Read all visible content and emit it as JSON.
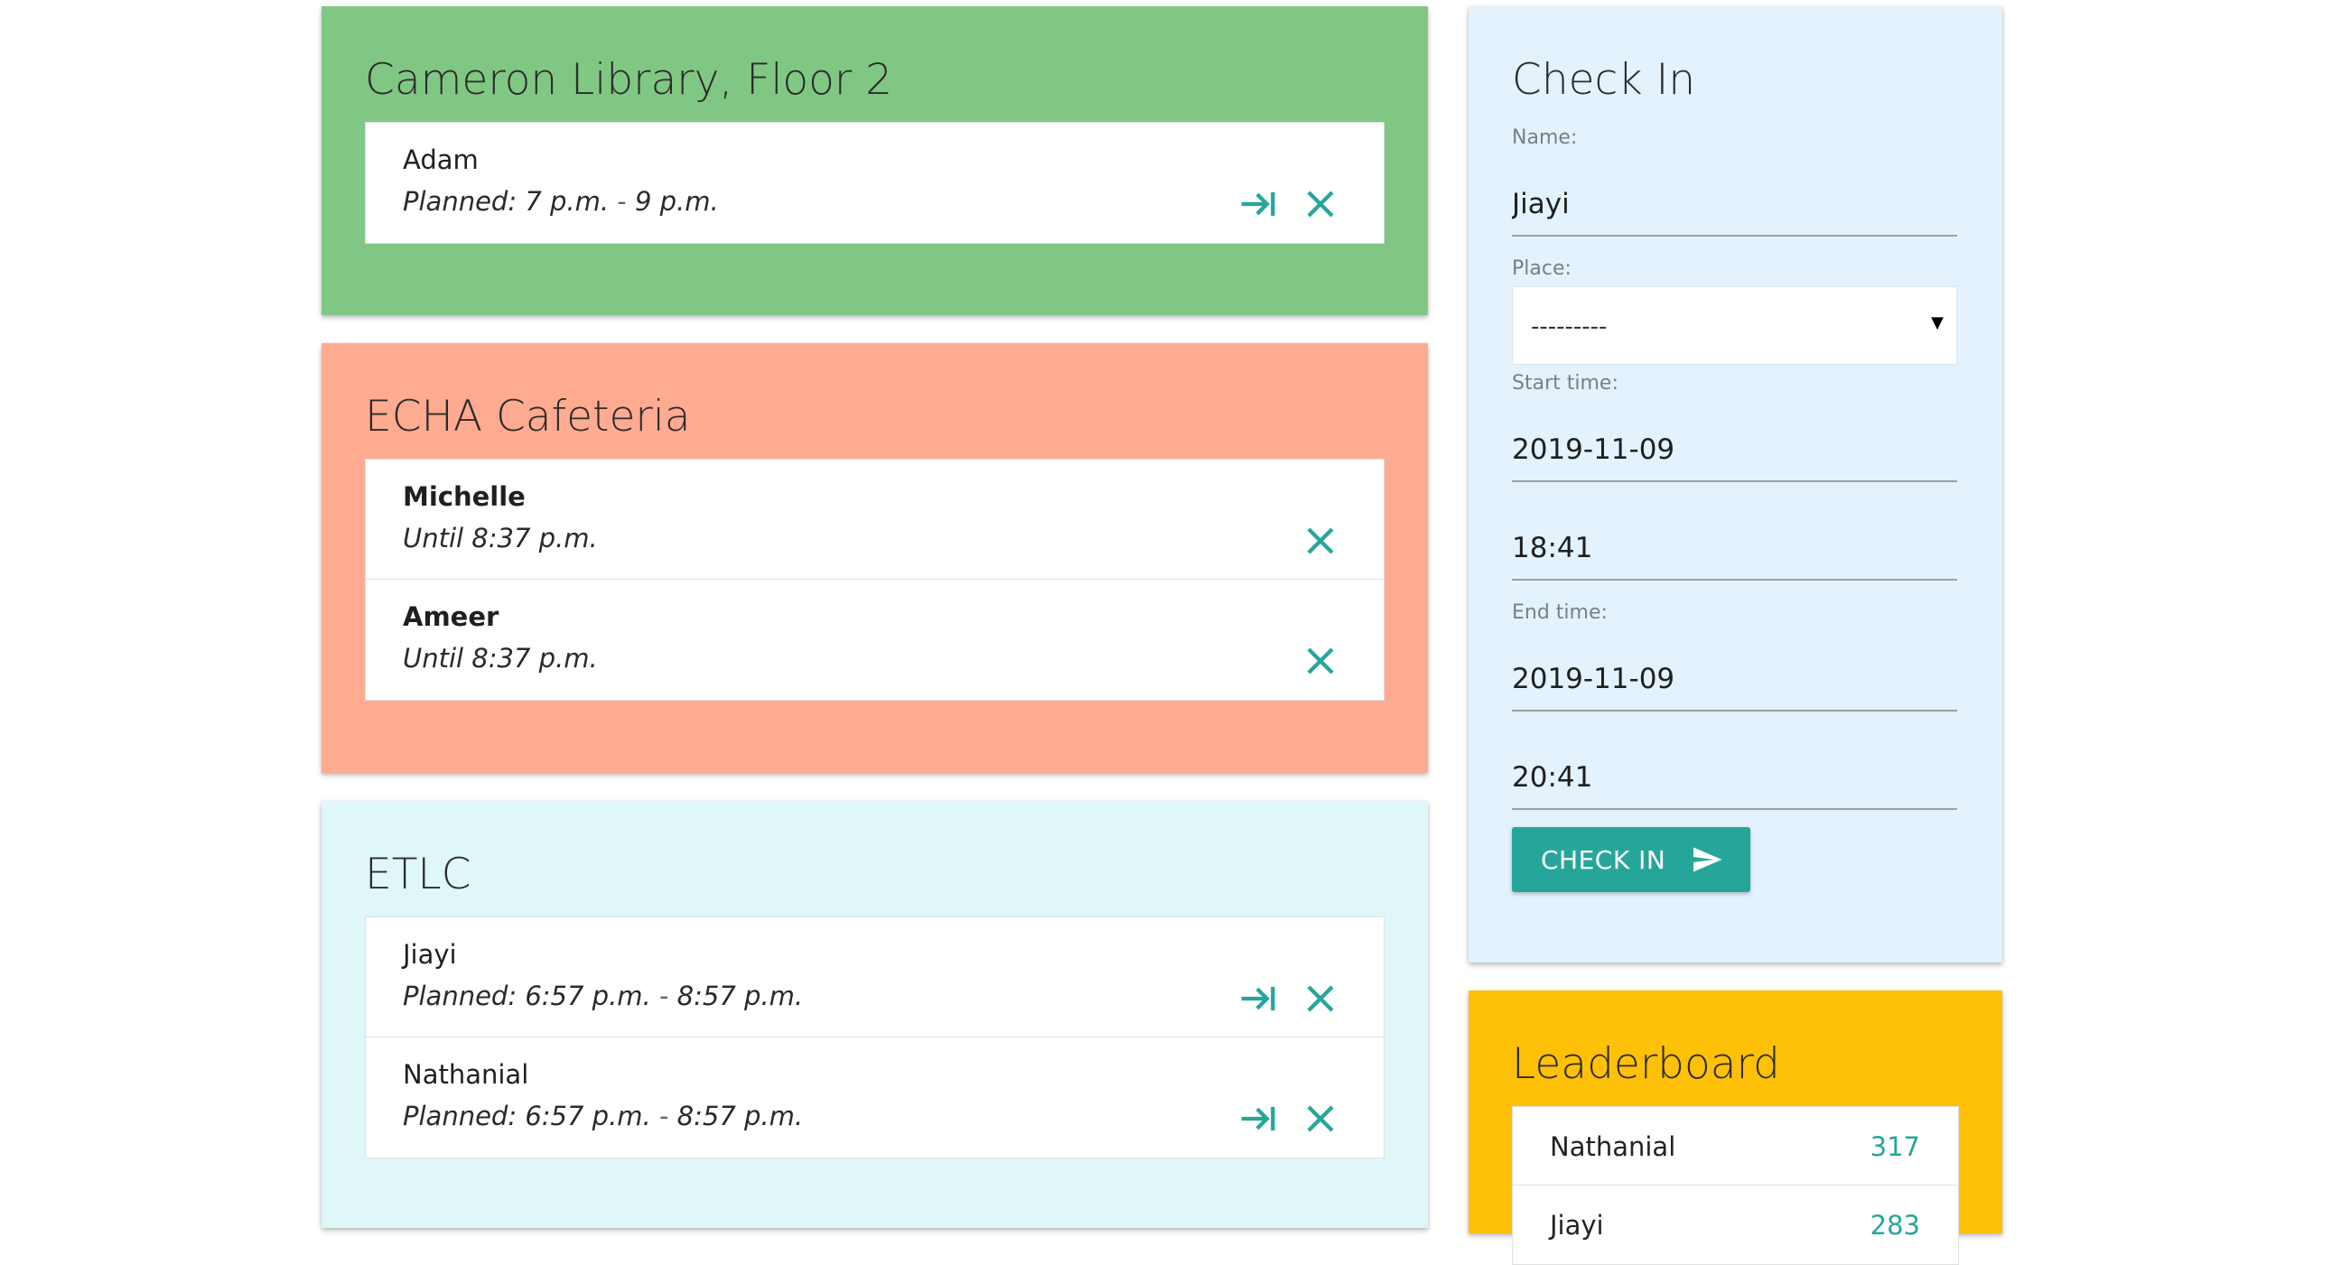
{
  "colors": {
    "accent": "#26a69a",
    "planned_card": "#81c784",
    "active_card": "#ffab91",
    "etlc_card": "#e0f7fa",
    "checkin_card": "#e3f2fd",
    "leaderboard_card": "#ffc107"
  },
  "places": [
    {
      "title": "Cameron Library, Floor 2",
      "items": [
        {
          "name": "Adam",
          "prefix": "Planned: 7 p.m.",
          "sep": " - ",
          "suffix": "9 p.m.",
          "checkin_icon": "arrow-to-line-icon",
          "remove_icon": "close-icon"
        }
      ]
    },
    {
      "title": "ECHA Cafeteria",
      "items": [
        {
          "name": "Michelle",
          "text": "Until 8:37 p.m.",
          "remove_icon": "close-icon"
        },
        {
          "name": "Ameer",
          "text": "Until 8:37 p.m.",
          "remove_icon": "close-icon"
        }
      ]
    },
    {
      "title": "ETLC",
      "items": [
        {
          "name": "Jiayi",
          "prefix": "Planned: 6:57 p.m.",
          "sep": " - ",
          "suffix": "8:57 p.m.",
          "checkin_icon": "arrow-to-line-icon",
          "remove_icon": "close-icon"
        },
        {
          "name": "Nathanial",
          "prefix": "Planned: 6:57 p.m.",
          "sep": " - ",
          "suffix": "8:57 p.m.",
          "checkin_icon": "arrow-to-line-icon",
          "remove_icon": "close-icon"
        }
      ]
    }
  ],
  "checkin": {
    "title": "Check In",
    "name_label": "Name:",
    "name_value": "Jiayi",
    "place_label": "Place:",
    "place_value": "---------",
    "start_label": "Start time:",
    "start_date": "2019-11-09",
    "start_time": "18:41",
    "end_label": "End time:",
    "end_date": "2019-11-09",
    "end_time": "20:41",
    "button_label": "CHECK IN",
    "button_icon": "send-icon"
  },
  "leaderboard": {
    "title": "Leaderboard",
    "rows": [
      {
        "name": "Nathanial",
        "score": "317"
      },
      {
        "name": "Jiayi",
        "score": "283"
      }
    ]
  }
}
